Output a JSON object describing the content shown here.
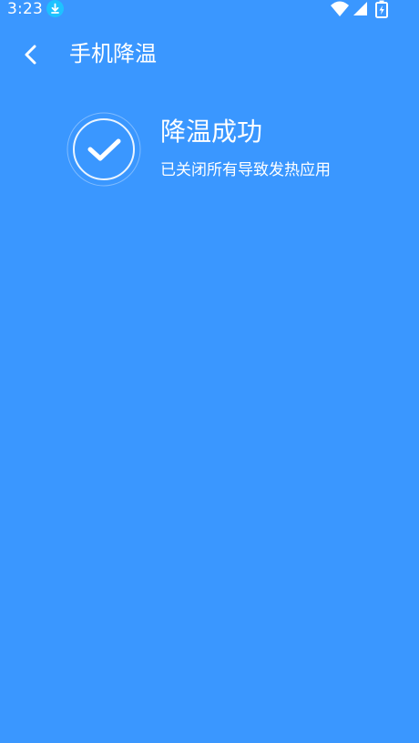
{
  "status_bar": {
    "time": "3:23",
    "icons": [
      "download-icon",
      "wifi-icon",
      "signal-icon",
      "battery-charging-icon"
    ]
  },
  "toolbar": {
    "back_icon": "back-arrow-icon",
    "title": "手机降温"
  },
  "result": {
    "icon": "check-circle-icon",
    "title": "降温成功",
    "subtitle": "已关闭所有导致发热应用"
  },
  "colors": {
    "background": "#3a97ff",
    "text": "#ffffff",
    "download_badge": "#1ec2ff"
  }
}
